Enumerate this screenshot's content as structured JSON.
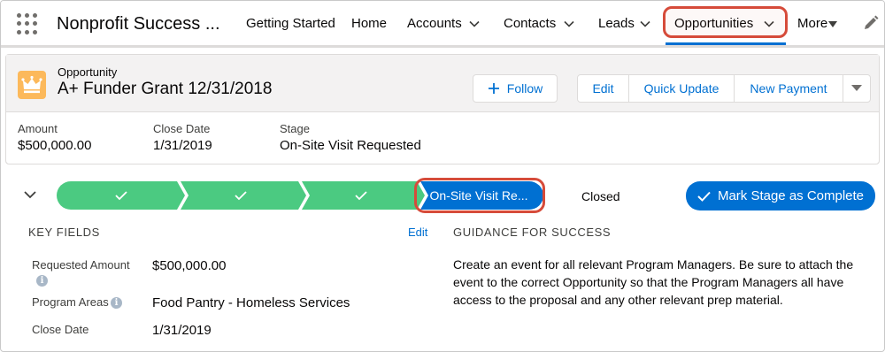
{
  "nav": {
    "app_name": "Nonprofit Success ...",
    "items": [
      {
        "label": "Getting Started"
      },
      {
        "label": "Home"
      },
      {
        "label": "Accounts"
      },
      {
        "label": "Contacts"
      },
      {
        "label": "Leads"
      },
      {
        "label": "Opportunities"
      },
      {
        "label": "More"
      }
    ],
    "active_item": "Opportunities"
  },
  "record": {
    "type_label": "Opportunity",
    "title": "A+ Funder Grant 12/31/2018",
    "icon": "crown-icon",
    "icon_color": "#fcb95b",
    "buttons": {
      "follow": "Follow",
      "edit": "Edit",
      "quick_update": "Quick Update",
      "new_payment": "New Payment"
    },
    "highlights": [
      {
        "label": "Amount",
        "value": "$500,000.00"
      },
      {
        "label": "Close Date",
        "value": "1/31/2019"
      },
      {
        "label": "Stage",
        "value": "On-Site Visit Requested"
      }
    ]
  },
  "path": {
    "completed_steps": 3,
    "current_stage": "On-Site Visit Re...",
    "next_stage": "Closed",
    "mark_button": "Mark Stage as Complete",
    "complete_color": "#4bca81",
    "current_color": "#0070d2"
  },
  "key_fields": {
    "title": "KEY FIELDS",
    "edit_label": "Edit",
    "fields": [
      {
        "label": "Requested Amount",
        "value": "$500,000.00"
      },
      {
        "label": "Program Areas",
        "value": "Food Pantry - Homeless Services"
      },
      {
        "label": "Close Date",
        "value": "1/31/2019"
      }
    ]
  },
  "guidance": {
    "title": "GUIDANCE FOR SUCCESS",
    "text": "Create an event for all relevant Program Managers. Be sure to attach the event to the correct Opportunity so that the Program Managers all have access to the proposal and any other relevant prep material."
  }
}
